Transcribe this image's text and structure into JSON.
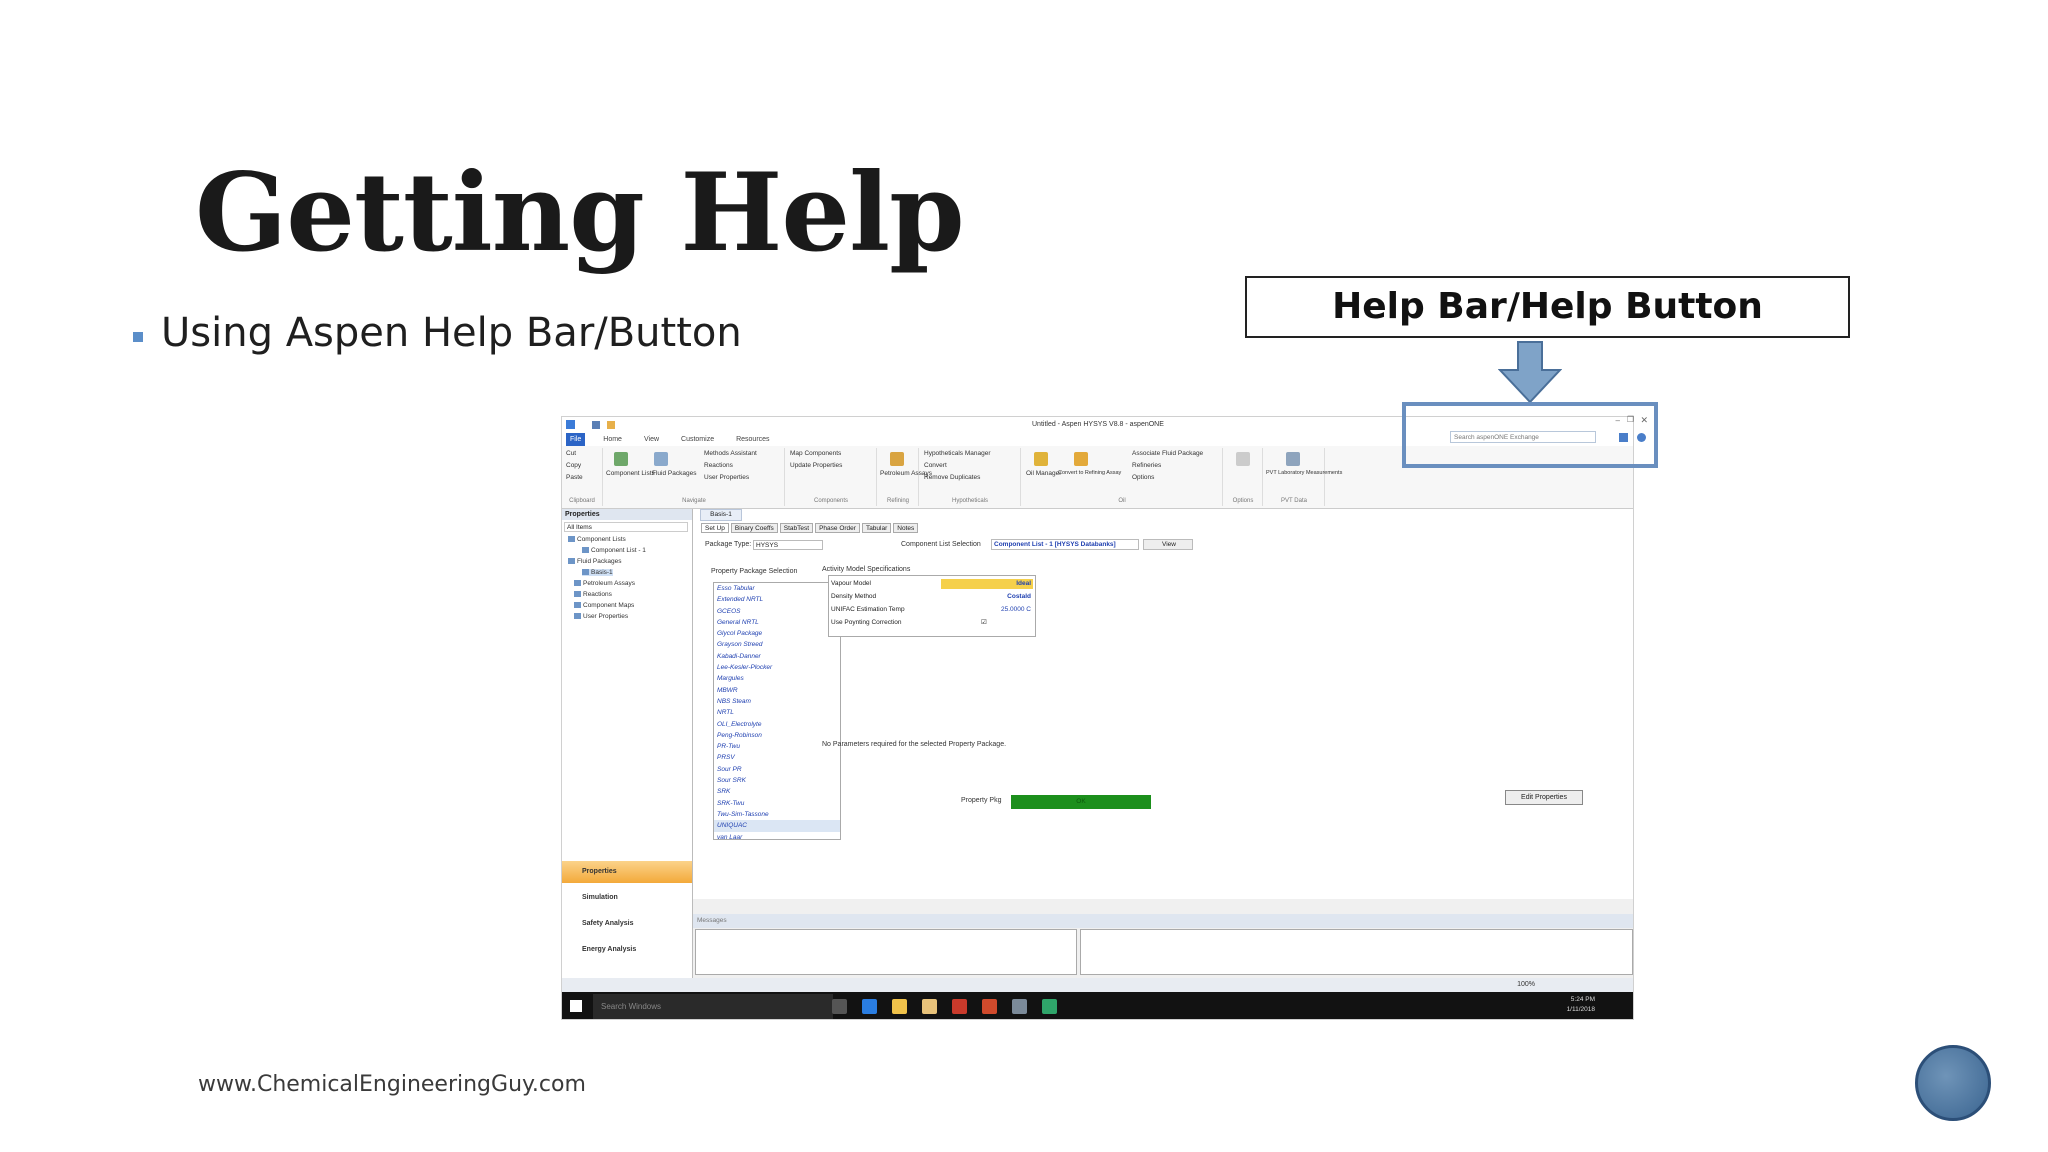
{
  "slide": {
    "title": "Getting Help",
    "bullet": "Using Aspen Help Bar/Button",
    "callout": "Help Bar/Help Button",
    "footer": "www.ChemicalEngineeringGuy.com"
  },
  "app": {
    "window_title": "Untitled - Aspen HYSYS V8.8 - aspenONE",
    "ribbon_tabs": [
      "File",
      "Home",
      "View",
      "Customize",
      "Resources"
    ],
    "ribbon": {
      "clipboard": {
        "cut": "Cut",
        "copy": "Copy",
        "paste": "Paste",
        "label": "Clipboard"
      },
      "navigate": {
        "component_lists": "Component Lists",
        "fluid_packages": "Fluid Packages",
        "methods_assistant": "Methods Assistant",
        "reactions": "Reactions",
        "user_properties": "User Properties",
        "label": "Navigate"
      },
      "components": {
        "map_components": "Map Components",
        "update_properties": "Update Properties",
        "label": "Components"
      },
      "refining": {
        "petroleum_assays": "Petroleum Assays",
        "label": "Refining"
      },
      "hypotheticals": {
        "hypo_manager": "Hypotheticals Manager",
        "convert": "Convert",
        "remove_duplicates": "Remove Duplicates",
        "label": "Hypotheticals"
      },
      "oil": {
        "oil_manager": "Oil Manager",
        "convert_refining": "Convert to Refining Assay",
        "associate": "Associate Fluid Package",
        "refineries": "Refineries",
        "options": "Options",
        "label": "Oil"
      },
      "options_label": "Options",
      "pvt": {
        "pvt_lab": "PVT Laboratory Measurements",
        "label": "PVT Data"
      }
    },
    "help_search_placeholder": "Search aspenONE Exchange",
    "nav": {
      "header": "Properties",
      "filter": "All Items",
      "tree": [
        "Component Lists",
        "Component List - 1",
        "Fluid Packages",
        "Basis-1",
        "Petroleum Assays",
        "Reactions",
        "Component Maps",
        "User Properties"
      ],
      "buttons": [
        "Properties",
        "Simulation",
        "Safety Analysis",
        "Energy Analysis"
      ]
    },
    "doc_tab": "Basis-1",
    "inner_tabs": [
      "Set Up",
      "Binary Coeffs",
      "StabTest",
      "Phase Order",
      "Tabular",
      "Notes"
    ],
    "package_type_label": "Package Type:",
    "package_type_value": "HYSYS",
    "component_list_label": "Component List Selection",
    "component_list_value": "Component List - 1 [HYSYS Databanks]",
    "view_button": "View",
    "pps_label": "Property Package Selection",
    "packages": [
      "Esso Tabular",
      "Extended NRTL",
      "GCEOS",
      "General NRTL",
      "Glycol Package",
      "Grayson Streed",
      "Kabadi-Danner",
      "Lee-Kesler-Plocker",
      "Margules",
      "MBWR",
      "NBS Steam",
      "NRTL",
      "OLI_Electrolyte",
      "Peng-Robinson",
      "PR-Twu",
      "PRSV",
      "Sour PR",
      "Sour SRK",
      "SRK",
      "SRK-Twu",
      "Twu-Sim-Tassone",
      "UNIQUAC",
      "van Laar"
    ],
    "activity_label": "Activity Model Specifications",
    "activity_rows": [
      {
        "name": "Vapour Model",
        "value": "Ideal"
      },
      {
        "name": "Density Method",
        "value": "Costald"
      },
      {
        "name": "UNIFAC Estimation Temp",
        "value": "25.0000 C"
      },
      {
        "name": "Use Poynting Correction",
        "value": "☑"
      }
    ],
    "no_params": "No Parameters required for the selected Property Package.",
    "property_pkg_label": "Property Pkg",
    "property_pkg_status": "OK",
    "edit_properties": "Edit Properties",
    "messages_label": "Messages",
    "zoom": "100%",
    "taskbar_search": "Search Windows",
    "clock_time": "5:24 PM",
    "clock_date": "1/11/2018"
  }
}
